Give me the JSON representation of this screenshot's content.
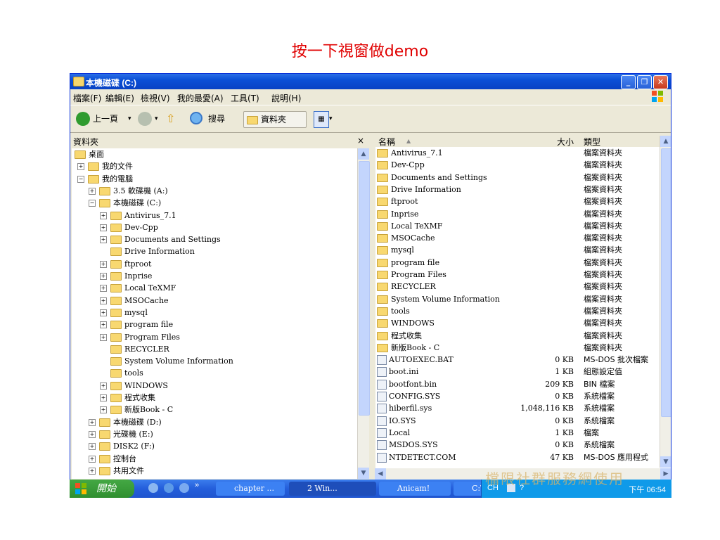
{
  "slide_title": "按一下視窗做demo",
  "window": {
    "title": "本機磁碟 (C:)",
    "menu": [
      "檔案(F)",
      "編輯(E)",
      "檢視(V)",
      "我的最愛(A)",
      "工具(T)",
      "說明(H)"
    ],
    "toolbar": {
      "back": "上一頁",
      "search": "搜尋",
      "folders": "資料夾"
    }
  },
  "folders_pane": {
    "header": "資料夾",
    "close": "×",
    "items": [
      {
        "label": "桌面",
        "level": 0,
        "expander": ""
      },
      {
        "label": "我的文件",
        "level": 1,
        "expander": "+"
      },
      {
        "label": "我的電腦",
        "level": 1,
        "expander": "−"
      },
      {
        "label": "3.5 軟碟機 (A:)",
        "level": 2,
        "expander": "+"
      },
      {
        "label": "本機磁碟 (C:)",
        "level": 2,
        "expander": "−"
      },
      {
        "label": "Antivirus_7.1",
        "level": 3,
        "expander": "+"
      },
      {
        "label": "Dev-Cpp",
        "level": 3,
        "expander": "+"
      },
      {
        "label": "Documents and Settings",
        "level": 3,
        "expander": "+"
      },
      {
        "label": "Drive Information",
        "level": 3,
        "expander": ""
      },
      {
        "label": "ftproot",
        "level": 3,
        "expander": "+"
      },
      {
        "label": "Inprise",
        "level": 3,
        "expander": "+"
      },
      {
        "label": "Local TeXMF",
        "level": 3,
        "expander": "+"
      },
      {
        "label": "MSOCache",
        "level": 3,
        "expander": "+"
      },
      {
        "label": "mysql",
        "level": 3,
        "expander": "+"
      },
      {
        "label": "program file",
        "level": 3,
        "expander": "+"
      },
      {
        "label": "Program Files",
        "level": 3,
        "expander": "+"
      },
      {
        "label": "RECYCLER",
        "level": 3,
        "expander": ""
      },
      {
        "label": "System Volume Information",
        "level": 3,
        "expander": ""
      },
      {
        "label": "tools",
        "level": 3,
        "expander": ""
      },
      {
        "label": "WINDOWS",
        "level": 3,
        "expander": "+"
      },
      {
        "label": "程式收集",
        "level": 3,
        "expander": "+"
      },
      {
        "label": "新版Book - C",
        "level": 3,
        "expander": "+"
      },
      {
        "label": "本機磁碟 (D:)",
        "level": 2,
        "expander": "+"
      },
      {
        "label": "光碟機 (E:)",
        "level": 2,
        "expander": "+"
      },
      {
        "label": "DISK2 (F:)",
        "level": 2,
        "expander": "+"
      },
      {
        "label": "控制台",
        "level": 2,
        "expander": "+"
      },
      {
        "label": "共用文件",
        "level": 2,
        "expander": "+"
      }
    ]
  },
  "file_list": {
    "columns": {
      "name": "名稱",
      "size": "大小",
      "type": "類型"
    },
    "rows": [
      {
        "name": "Antivirus_7.1",
        "size": "",
        "type": "檔案資料夾",
        "icon": "folder"
      },
      {
        "name": "Dev-Cpp",
        "size": "",
        "type": "檔案資料夾",
        "icon": "folder"
      },
      {
        "name": "Documents and Settings",
        "size": "",
        "type": "檔案資料夾",
        "icon": "folder"
      },
      {
        "name": "Drive Information",
        "size": "",
        "type": "檔案資料夾",
        "icon": "folder"
      },
      {
        "name": "ftproot",
        "size": "",
        "type": "檔案資料夾",
        "icon": "folder"
      },
      {
        "name": "Inprise",
        "size": "",
        "type": "檔案資料夾",
        "icon": "folder"
      },
      {
        "name": "Local TeXMF",
        "size": "",
        "type": "檔案資料夾",
        "icon": "folder"
      },
      {
        "name": "MSOCache",
        "size": "",
        "type": "檔案資料夾",
        "icon": "folder"
      },
      {
        "name": "mysql",
        "size": "",
        "type": "檔案資料夾",
        "icon": "folder"
      },
      {
        "name": "program file",
        "size": "",
        "type": "檔案資料夾",
        "icon": "folder"
      },
      {
        "name": "Program Files",
        "size": "",
        "type": "檔案資料夾",
        "icon": "folder"
      },
      {
        "name": "RECYCLER",
        "size": "",
        "type": "檔案資料夾",
        "icon": "folder"
      },
      {
        "name": "System Volume Information",
        "size": "",
        "type": "檔案資料夾",
        "icon": "folder"
      },
      {
        "name": "tools",
        "size": "",
        "type": "檔案資料夾",
        "icon": "folder"
      },
      {
        "name": "WINDOWS",
        "size": "",
        "type": "檔案資料夾",
        "icon": "folder"
      },
      {
        "name": "程式收集",
        "size": "",
        "type": "檔案資料夾",
        "icon": "folder"
      },
      {
        "name": "新版Book - C",
        "size": "",
        "type": "檔案資料夾",
        "icon": "folder"
      },
      {
        "name": "AUTOEXEC.BAT",
        "size": "0 KB",
        "type": "MS-DOS 批次檔案",
        "icon": "file"
      },
      {
        "name": "boot.ini",
        "size": "1 KB",
        "type": "組態設定值",
        "icon": "file"
      },
      {
        "name": "bootfont.bin",
        "size": "209 KB",
        "type": "BIN 檔案",
        "icon": "file"
      },
      {
        "name": "CONFIG.SYS",
        "size": "0 KB",
        "type": "系統檔案",
        "icon": "file"
      },
      {
        "name": "hiberfil.sys",
        "size": "1,048,116 KB",
        "type": "系統檔案",
        "icon": "file"
      },
      {
        "name": "IO.SYS",
        "size": "0 KB",
        "type": "系統檔案",
        "icon": "file"
      },
      {
        "name": "Local",
        "size": "1 KB",
        "type": "檔案",
        "icon": "file"
      },
      {
        "name": "MSDOS.SYS",
        "size": "0 KB",
        "type": "系統檔案",
        "icon": "file"
      },
      {
        "name": "NTDETECT.COM",
        "size": "47 KB",
        "type": "MS-DOS 應用程式",
        "icon": "file"
      }
    ]
  },
  "taskbar": {
    "start": "開始",
    "tasks": [
      "chapter ...",
      "2 Win...",
      "Anicam!",
      "C:\\WIN..."
    ],
    "lang": "CH",
    "clock": "下午 06:54"
  },
  "watermark": "檔限社群服務網使用"
}
